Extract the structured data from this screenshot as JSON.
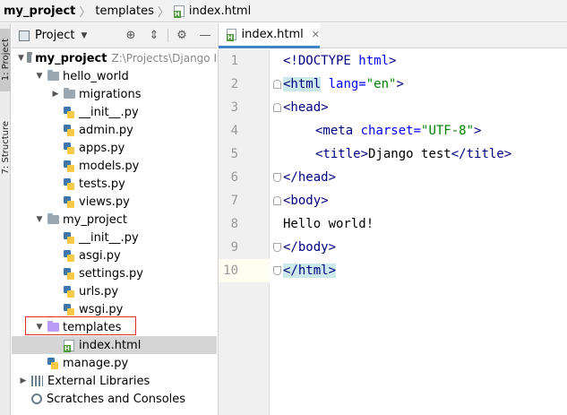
{
  "breadcrumb": {
    "project": "my_project",
    "folder": "templates",
    "file": "index.html"
  },
  "tool_strip": {
    "project_tab": "1: Project",
    "structure_tab": "7: Structure"
  },
  "project_panel": {
    "title": "Project",
    "tree": [
      {
        "label": "my_project",
        "path": "Z:\\Projects\\Django I"
      },
      {
        "label": "hello_world"
      },
      {
        "label": "migrations"
      },
      {
        "label": "__init__.py"
      },
      {
        "label": "admin.py"
      },
      {
        "label": "apps.py"
      },
      {
        "label": "models.py"
      },
      {
        "label": "tests.py"
      },
      {
        "label": "views.py"
      },
      {
        "label": "my_project"
      },
      {
        "label": "__init__.py"
      },
      {
        "label": "asgi.py"
      },
      {
        "label": "settings.py"
      },
      {
        "label": "urls.py"
      },
      {
        "label": "wsgi.py"
      },
      {
        "label": "templates"
      },
      {
        "label": "index.html"
      },
      {
        "label": "manage.py"
      },
      {
        "label": "External Libraries"
      },
      {
        "label": "Scratches and Consoles"
      }
    ]
  },
  "editor": {
    "tab_label": "index.html",
    "line_numbers": [
      "1",
      "2",
      "3",
      "4",
      "5",
      "6",
      "7",
      "8",
      "9",
      "10"
    ],
    "lines": [
      {
        "a": "<!DOCTYPE ",
        "b": "html",
        "c": ">"
      },
      {
        "a": "<html",
        "b": " lang=",
        "c": "\"en\"",
        "d": ">"
      },
      {
        "a": "<head>"
      },
      {
        "a": "<meta",
        "b": " charset=",
        "c": "\"UTF-8\"",
        "d": ">"
      },
      {
        "a": "<title>",
        "b": "Django test",
        "c": "</title>"
      },
      {
        "a": "</head>"
      },
      {
        "a": "<body>"
      },
      {
        "a": "Hello world!"
      },
      {
        "a": "</body>"
      },
      {
        "a": "</html>"
      }
    ]
  }
}
